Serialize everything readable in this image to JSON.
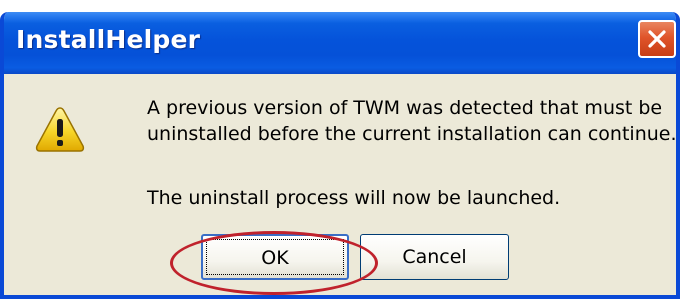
{
  "window": {
    "title": "InstallHelper",
    "close_icon": "close-icon"
  },
  "message": {
    "icon": "warning-icon",
    "line1": "A previous version of TWM was detected that must be",
    "line2": "uninstalled before the current installation can continue.",
    "line3": "The uninstall process will now be launched."
  },
  "buttons": {
    "ok_label": "OK",
    "cancel_label": "Cancel"
  },
  "colors": {
    "titlebar": "#0553da",
    "dialog_bg": "#ece9d8",
    "close_button": "#e0542a",
    "highlight_ellipse": "#c0222c"
  }
}
